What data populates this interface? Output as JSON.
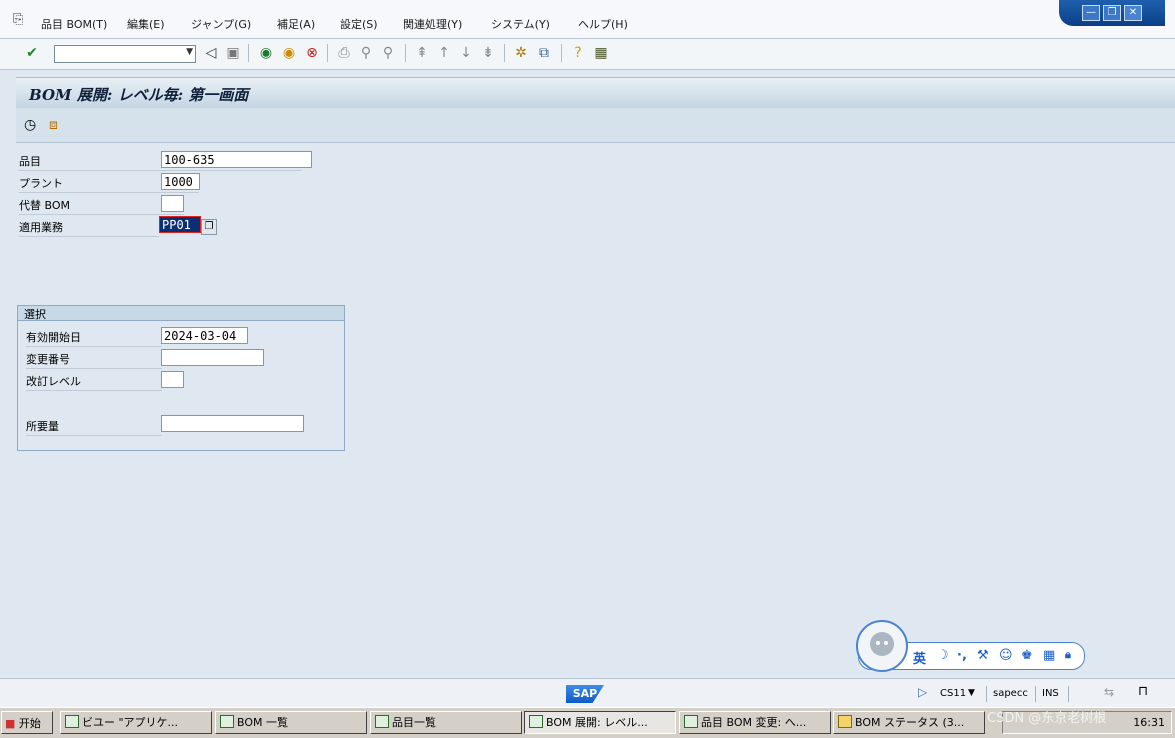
{
  "menubar": {
    "items": [
      "品目 BOM(T)",
      "編集(E)",
      "ジャンプ(G)",
      "補足(A)",
      "設定(S)",
      "関連処理(Y)",
      "システム(Y)",
      "ヘルプ(H)"
    ]
  },
  "window_controls": {
    "minimize": "—",
    "restore": "❐",
    "close": "✕"
  },
  "toolbar": {
    "command_value": ""
  },
  "title": {
    "text": "BOM 展開: レベル毎: 第一画面"
  },
  "form": {
    "material": {
      "label": "品目",
      "value": "100-635"
    },
    "plant": {
      "label": "プラント",
      "value": "1000"
    },
    "alt_bom": {
      "label": "代替 BOM",
      "value": ""
    },
    "bom_usage": {
      "label": "適用業務",
      "value": "PP01"
    }
  },
  "selection": {
    "title": "選択",
    "valid_from": {
      "label": "有効開始日",
      "value": "2024-03-04"
    },
    "change_number": {
      "label": "変更番号",
      "value": ""
    },
    "revision_level": {
      "label": "改訂レベル",
      "value": ""
    },
    "required_qty": {
      "label": "所要量",
      "value": ""
    }
  },
  "ime": {
    "mode": "英"
  },
  "statusbar": {
    "transaction": "CS11",
    "server": "sapecc",
    "mode": "INS"
  },
  "taskbar": {
    "start": "开始",
    "tasks": [
      "ビユー \"アプリケ...",
      "BOM 一覧",
      "品目一覧",
      "BOM 展開: レベル...",
      "品目 BOM 変更: へ...",
      "BOM ステータス (3..."
    ],
    "clock": "16:31",
    "watermark": "CSDN @东京老树根"
  },
  "colors": {
    "background": "#dfe8f0",
    "title_bar": "#c4d5e3",
    "selected_field": "#0b2f75",
    "sap_blue": "#0d5bc5"
  }
}
